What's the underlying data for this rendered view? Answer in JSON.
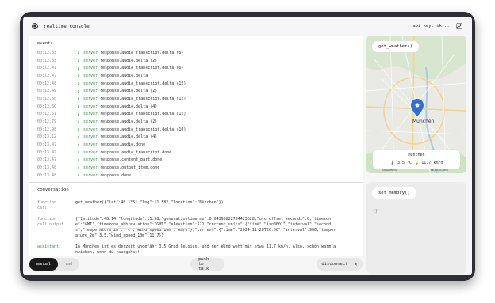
{
  "app": {
    "title": "realtime console",
    "api_key_label": "api key: sk-..."
  },
  "events": {
    "title": "events",
    "rows": [
      {
        "time": "00:12.35",
        "source": "server",
        "name": "response.audio_transcript.delta (6)"
      },
      {
        "time": "00:12.35",
        "source": "server",
        "name": "response.audio.delta (2)"
      },
      {
        "time": "00:12.41",
        "source": "server",
        "name": "response.audio_transcript.delta (6)"
      },
      {
        "time": "00:12.47",
        "source": "server",
        "name": "response.audio.delta"
      },
      {
        "time": "00:12.48",
        "source": "server",
        "name": "response.audio_transcript.delta (12)"
      },
      {
        "time": "00:12.49",
        "source": "server",
        "name": "response.audio.delta (2)"
      },
      {
        "time": "00:12.50",
        "source": "server",
        "name": "response.audio_transcript.delta (12)"
      },
      {
        "time": "00:12.60",
        "source": "server",
        "name": "response.audio.delta (4)"
      },
      {
        "time": "00:12.61",
        "source": "server",
        "name": "response.audio_transcript.delta (12)"
      },
      {
        "time": "00:12.79",
        "source": "server",
        "name": "response.audio.delta (2)"
      },
      {
        "time": "00:12.98",
        "source": "server",
        "name": "response.audio_transcript.delta (10)"
      },
      {
        "time": "00:13.12",
        "source": "server",
        "name": "response.audio.delta (4)"
      },
      {
        "time": "00:13.47",
        "source": "server",
        "name": "response.audio.done"
      },
      {
        "time": "00:13.47",
        "source": "server",
        "name": "response.audio_transcript.done"
      },
      {
        "time": "00:13.47",
        "source": "server",
        "name": "response.content_part.done"
      },
      {
        "time": "00:13.48",
        "source": "server",
        "name": "response.output_item.done"
      },
      {
        "time": "00:13.48",
        "source": "server",
        "name": "response.done"
      }
    ]
  },
  "conversation": {
    "title": "conversation",
    "items": [
      {
        "role": "function\ncall",
        "text": "get_weather({\"lat\":48.1351,\"lng\":11.582,\"location\":\"München\"})"
      },
      {
        "role": "function\ncall output",
        "text": "{\"latitude\":48.14,\"longitude\":11.58,\"generationtime_ms\":0.04398822784423828,\"utc_offset_seconds\":0,\"timezone\":\"GMT\",\"timezone_abbreviation\":\"GMT\",\"elevation\":521,\"current_units\":{\"time\":\"iso8601\",\"interval\":\"seconds\",\"temperature_2m\":\"°C\",\"wind_speed_10m\":\"km/h\"},\"current\":{\"time\":\"2024-11-28T20:00\",\"interval\":900,\"temperature_2m\":3.5,\"wind_speed_10m\":11.7}}"
      },
      {
        "role": "assistant",
        "text": "In München ist es derzeit ungefähr 3,5 Grad Celsius, und der Wind weht mit etwa 11,7 km/h. Also, schön warm anziehen, wenn du rausgehst!"
      }
    ]
  },
  "controls": {
    "mode_options": [
      "manual",
      "vad"
    ],
    "mode_selected": "manual",
    "push_label": "push to talk",
    "disconnect_label": "disconnect"
  },
  "weather": {
    "function_label": "get_weather()",
    "city": "München",
    "values": "🌡 3.5 °C  🍃 11.7 km/h",
    "map_labels": {
      "center": "München",
      "south": "Grünwald",
      "southeast": "Taufkirchen"
    }
  },
  "memory": {
    "function_label": "set_memory()",
    "value": "{}"
  },
  "colors": {
    "server_accent": "#2e9b3c",
    "frame": "#2e2f34",
    "pin": "#2f6fd6"
  }
}
